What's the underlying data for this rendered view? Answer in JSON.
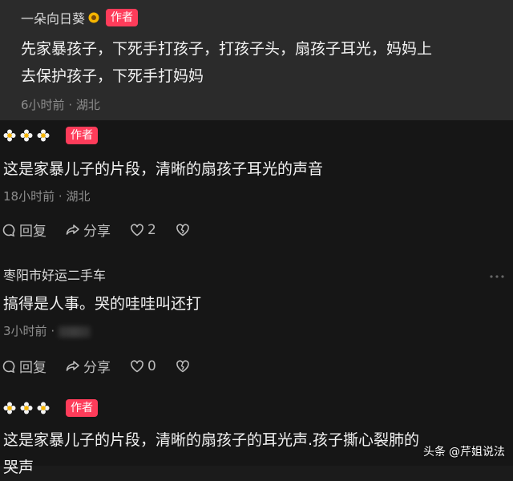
{
  "comments": [
    {
      "username": "一朵向日葵",
      "author_badge": "作者",
      "text": "先家暴孩子，下死手打孩子，打孩子头，扇孩子耳光，妈妈上\n去保护孩子，下死手打妈妈",
      "time": "6小时前",
      "location": "湖北"
    },
    {
      "username": "",
      "author_badge": "作者",
      "text": "这是家暴儿子的片段，清晰的扇孩子耳光的声音",
      "time": "18小时前",
      "location": "湖北",
      "reply_label": "回复",
      "share_label": "分享",
      "like_count": "2"
    },
    {
      "username": "枣阳市好运二手车",
      "text": "搞得是人事。哭的哇哇叫还打",
      "time": "3小时前",
      "reply_label": "回复",
      "share_label": "分享",
      "like_count": "0"
    },
    {
      "username": "",
      "author_badge": "作者",
      "text": "这是家暴儿子的片段，清晰的扇孩子的耳光声.孩子撕心裂肺的\n哭声"
    }
  ],
  "separator": "·",
  "watermark": {
    "brand": "头条",
    "account": "@芹姐说法"
  }
}
